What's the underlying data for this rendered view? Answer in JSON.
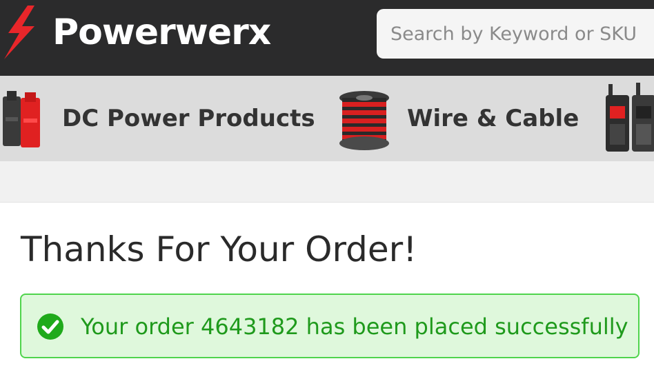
{
  "header": {
    "logo_text": "Powerwerx",
    "search": {
      "placeholder": "Search by Keyword or SKU",
      "value": ""
    }
  },
  "categories": [
    {
      "label": "DC Power Products",
      "icon": "connector-icon"
    },
    {
      "label": "Wire & Cable",
      "icon": "wire-spool-icon"
    },
    {
      "label": "",
      "icon": "radio-icon"
    }
  ],
  "main": {
    "title": "Thanks For Your Order!",
    "alert": {
      "text": "Your order 4643182 has been placed successfully",
      "icon": "check-circle-icon"
    }
  },
  "colors": {
    "header_bg": "#2b2b2c",
    "brand_red": "#e8262a",
    "category_bg": "#dcdcdc",
    "success_bg": "#dff8dc",
    "success_border": "#4fd44c",
    "success_text": "#1f9a1c"
  }
}
